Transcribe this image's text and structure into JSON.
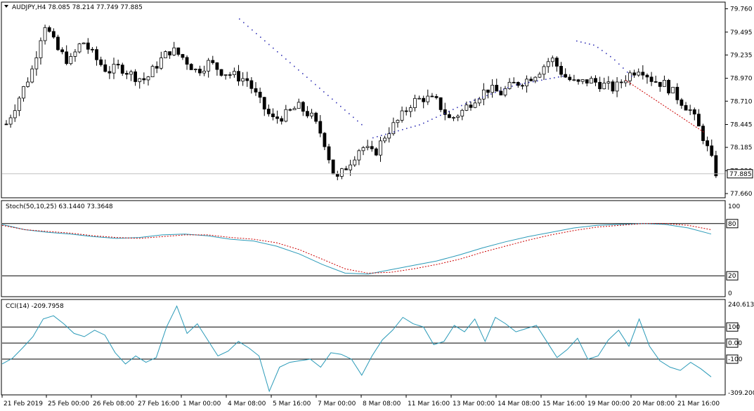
{
  "header": {
    "symbol_line": "AUDJPY,H4  78.085 78.214 77.749 77.885"
  },
  "chart_data": [
    {
      "type": "candlestick",
      "title": "AUDJPY,H4  78.085 78.214 77.749 77.885",
      "symbol": "AUDJPY",
      "timeframe": "H4",
      "last_bar": {
        "open": 78.085,
        "high": 78.214,
        "low": 77.749,
        "close": 77.885
      },
      "current_price_label": "77.885",
      "y_ticks": [
        "79.760",
        "79.495",
        "79.235",
        "78.970",
        "78.710",
        "78.445",
        "78.185",
        "77.920",
        "77.660"
      ],
      "ylim": [
        77.62,
        79.82
      ],
      "x_ticks": [
        "21 Feb 2019",
        "25 Feb 00:00",
        "26 Feb 08:00",
        "27 Feb 16:00",
        "1 Mar 00:00",
        "4 Mar 08:00",
        "5 Mar 16:00",
        "7 Mar 00:00",
        "8 Mar 08:00",
        "11 Mar 16:00",
        "13 Mar 00:00",
        "14 Mar 08:00",
        "15 Mar 16:00",
        "19 Mar 00:00",
        "20 Mar 08:00",
        "21 Mar 16:00"
      ],
      "close_path": [
        78.45,
        78.75,
        79.05,
        79.6,
        79.3,
        79.15,
        79.4,
        79.2,
        79.05,
        79.1,
        79.0,
        78.95,
        79.15,
        79.3,
        79.2,
        79.05,
        79.15,
        79.05,
        79.0,
        78.95,
        78.7,
        78.5,
        78.55,
        78.65,
        78.55,
        78.3,
        77.8,
        78.0,
        78.2,
        78.1,
        78.35,
        78.5,
        78.7,
        78.75,
        78.7,
        78.5,
        78.6,
        78.75,
        78.85,
        78.8,
        78.9,
        78.95,
        79.05,
        79.2,
        79.0,
        78.9,
        78.95,
        78.9,
        78.85,
        79.0,
        79.1,
        78.95,
        78.9,
        78.75,
        78.6,
        78.3,
        77.9
      ],
      "sar_upper": [
        79.65,
        79.45,
        79.25,
        79.05,
        78.85,
        78.65,
        78.45
      ],
      "sar_lower": [
        78.3,
        78.45,
        78.7,
        78.9,
        79.0
      ],
      "colors": {
        "bull": "#ffffff",
        "bear": "#000000",
        "wick": "#000000",
        "sar": "#3a3ab8",
        "trend": "#cc0000"
      }
    },
    {
      "type": "line",
      "title": "Stoch(50,10,25) 63.1440 73.3648",
      "y_ticks": [
        "100",
        "80",
        "20",
        "0"
      ],
      "ylim": [
        0,
        100
      ],
      "levels": [
        80,
        20
      ],
      "series": [
        {
          "name": "Main",
          "color": "#2a9ab8",
          "values": [
            79,
            73,
            70,
            68,
            65,
            63,
            64,
            67,
            68,
            66,
            62,
            60,
            54,
            45,
            33,
            23,
            22,
            27,
            32,
            37,
            44,
            52,
            59,
            65,
            70,
            75,
            78,
            79,
            80,
            79,
            75,
            68
          ]
        },
        {
          "name": "Signal",
          "color": "#cc0000",
          "values": [
            78,
            73,
            71,
            69,
            66,
            64,
            63,
            65,
            67,
            67,
            64,
            62,
            58,
            50,
            39,
            28,
            23,
            24,
            28,
            33,
            39,
            47,
            54,
            61,
            67,
            72,
            76,
            78,
            80,
            80,
            78,
            73
          ]
        }
      ]
    },
    {
      "type": "line",
      "title": "CCI(14) -209.7958",
      "y_ticks": [
        "240.6133",
        "100",
        "0.00",
        "-100",
        "-309.2006"
      ],
      "ylim": [
        -309.2006,
        240.6133
      ],
      "levels": [
        100,
        0,
        -100
      ],
      "series": [
        {
          "name": "CCI",
          "color": "#2a9ab8",
          "values": [
            -130,
            -95,
            -30,
            40,
            150,
            170,
            120,
            60,
            40,
            80,
            50,
            -60,
            -130,
            -80,
            -120,
            -90,
            100,
            230,
            60,
            120,
            20,
            -80,
            -50,
            10,
            -30,
            -80,
            -300,
            -150,
            -120,
            -110,
            -100,
            -150,
            -60,
            -70,
            -100,
            -200,
            -80,
            20,
            80,
            160,
            120,
            100,
            -10,
            10,
            110,
            70,
            150,
            10,
            160,
            120,
            70,
            90,
            110,
            10,
            -90,
            -40,
            30,
            -100,
            -80,
            20,
            80,
            -20,
            150,
            -20,
            -110,
            -150,
            -170,
            -120,
            -160,
            -210
          ]
        }
      ]
    }
  ]
}
